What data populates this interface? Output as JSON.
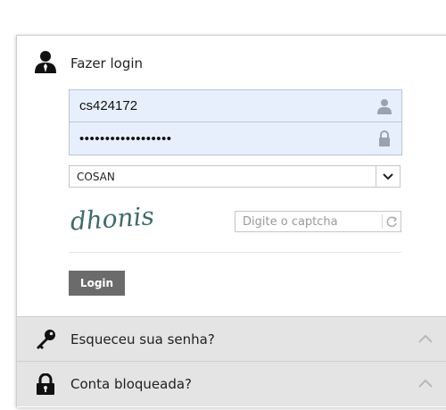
{
  "login": {
    "title": "Fazer login",
    "username_value": "cs424172",
    "password_value": "••••••••••••••••••",
    "company_selected": "COSAN",
    "captcha_image_text": "dhonis",
    "captcha_placeholder": "Digite o captcha",
    "login_button": "Login"
  },
  "sections": {
    "forgot_password": "Esqueceu sua senha?",
    "account_locked": "Conta bloqueada?"
  },
  "icons": {
    "header": "user-icon",
    "username": "person-icon",
    "password": "lock-icon",
    "select": "chevron-down-icon",
    "captcha_refresh": "refresh-icon",
    "forgot": "key-icon",
    "locked": "padlock-icon",
    "expand": "chevron-up-icon"
  },
  "colors": {
    "input_bg": "#e8effc",
    "button_bg": "#6b6b6b",
    "section_bg": "#e4e4e4",
    "captcha_text": "#3f6b6b"
  }
}
